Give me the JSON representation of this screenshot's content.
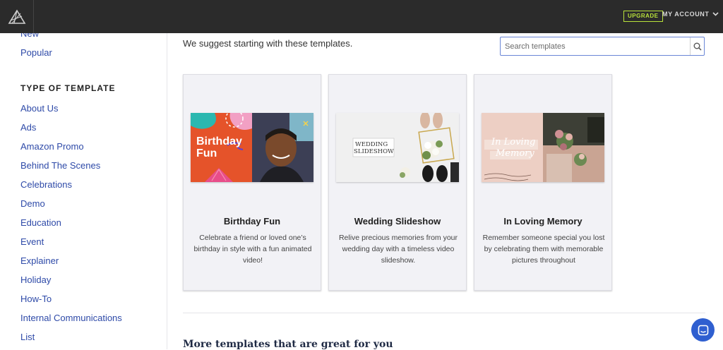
{
  "header": {
    "logo": "animoto-logo-icon",
    "upgrade_label": "UPGRADE",
    "account_label": "MY ACCOUNT",
    "colors": {
      "bar": "#2b2b2b",
      "upgrade": "#b9e23a"
    }
  },
  "sidebar": {
    "top_items": [
      {
        "label": "New"
      },
      {
        "label": "Popular"
      }
    ],
    "section_heading": "TYPE OF TEMPLATE",
    "items": [
      {
        "label": "About Us"
      },
      {
        "label": "Ads"
      },
      {
        "label": "Amazon Promo"
      },
      {
        "label": "Behind The Scenes"
      },
      {
        "label": "Celebrations"
      },
      {
        "label": "Demo"
      },
      {
        "label": "Education"
      },
      {
        "label": "Event"
      },
      {
        "label": "Explainer"
      },
      {
        "label": "Holiday"
      },
      {
        "label": "How-To"
      },
      {
        "label": "Internal Communications"
      },
      {
        "label": "List"
      }
    ],
    "link_color": "#2e4aa8"
  },
  "main": {
    "suggest_text": "We suggest starting with these templates.",
    "search": {
      "placeholder": "Search templates",
      "value": ""
    },
    "cards": [
      {
        "title": "Birthday Fun",
        "description": "Celebrate a friend or loved one’s birthday in style with a fun animated video!",
        "thumb_text": [
          "Birthday",
          "Fun"
        ]
      },
      {
        "title": "Wedding Slideshow",
        "description": "Relive precious memories from your wedding day with a timeless video slideshow.",
        "thumb_text": [
          "WEDDING",
          "SLIDESHOW"
        ]
      },
      {
        "title": "In Loving Memory",
        "description": "Remember someone special you lost by celebrating them with memorable pictures throughout",
        "thumb_text": [
          "In Loving",
          "Memory"
        ]
      }
    ],
    "more_heading": "More templates that are great for you"
  },
  "chat": {
    "icon": "chat-icon",
    "color": "#2f5fd0"
  }
}
